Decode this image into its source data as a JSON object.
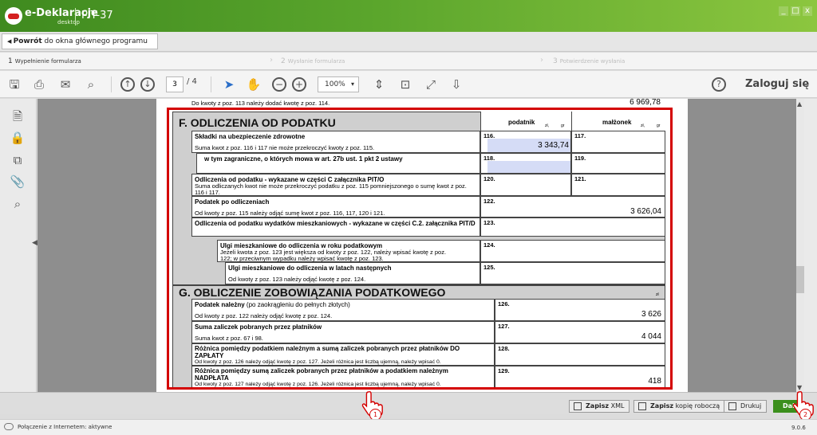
{
  "app": {
    "brand": "e-Deklaracje",
    "brand_sub": "desktop",
    "title": "PIT-37",
    "window_controls": [
      "_",
      "□",
      "x"
    ]
  },
  "nav": {
    "back_bold": "Powrót",
    "back_rest": " do okna głównego programu"
  },
  "steps": [
    {
      "num": "1",
      "label": "Wypełnienie formularza",
      "active": true
    },
    {
      "num": "2",
      "label": "Wysłanie formularza",
      "active": false
    },
    {
      "num": "3",
      "label": "Potwierdzenie wysłania",
      "active": false
    }
  ],
  "toolbar": {
    "page_current": "3",
    "page_total": "/ 4",
    "zoom": "100%",
    "login": "Zaloguj się",
    "icons": [
      "save-icon",
      "print-icon",
      "mail-icon",
      "search-icon",
      "arrow-up-icon",
      "arrow-down-icon",
      "cursor-icon",
      "hand-icon",
      "zoom-out-icon",
      "zoom-in-icon",
      "fit-height-icon",
      "fit-page-icon",
      "fullscreen-icon",
      "download-icon",
      "help-icon"
    ]
  },
  "sidebar_icons": [
    "document-icon",
    "lock-icon",
    "copy-icon",
    "attachment-icon",
    "search-icon"
  ],
  "form": {
    "top_note": "Do kwoty z poz. 113 należy dodać kwotę z poz. 114.",
    "top_value": "6 969,78",
    "section_f": {
      "title": "F. ODLICZENIA OD PODATKU",
      "col_podatnik": "podatnik",
      "col_malzonek": "małżonek",
      "unit_zl": "zł,",
      "unit_gr": "gr",
      "rows": [
        {
          "label": "Składki na ubezpieczenie zdrowotne",
          "note": "Suma kwot z poz. 116 i 117 nie może przekroczyć kwoty z poz. 115.",
          "pos_a": "116.",
          "val_a": "3 343,74",
          "pos_b": "117."
        },
        {
          "label": "w tym zagraniczne, o których mowa w art. 27b ust. 1 pkt 2 ustawy",
          "note": "",
          "pos_a": "118.",
          "val_a": "",
          "pos_b": "119."
        },
        {
          "label": "Odliczenia od podatku - wykazane w części C załącznika PIT/O",
          "note": "Suma odliczanych kwot nie może przekroczyć podatku z poz. 115 pomniejszonego o sumę kwot z poz. 116 i 117.",
          "pos_a": "120.",
          "val_a": "",
          "pos_b": "121."
        },
        {
          "label": "Podatek po odliczeniach",
          "note": "Od kwoty z poz. 115 należy odjąć sumę kwot z poz. 116, 117, 120 i 121.",
          "pos_a": "122.",
          "val_a": "3 626,04"
        },
        {
          "label": "Odliczenia od podatku wydatków mieszkaniowych - wykazane w części C.2. załącznika PIT/D",
          "note": "",
          "pos_a": "123.",
          "val_a": ""
        },
        {
          "label": "Ulgi mieszkaniowe do odliczenia w roku podatkowym",
          "note": "Jeżeli kwota z poz. 123 jest większa od kwoty z poz. 122, należy wpisać kwotę z poz. 122; w przeciwnym wypadku należy wpisać kwotę z poz. 123.",
          "pos_a": "124.",
          "val_a": ""
        },
        {
          "label": "Ulgi mieszkaniowe do odliczenia w latach następnych",
          "note": "Od kwoty z poz. 123 należy odjąć kwotę z poz. 124.",
          "pos_a": "125.",
          "val_a": ""
        }
      ]
    },
    "section_g": {
      "title": "G. OBLICZENIE ZOBOWIĄZANIA PODATKOWEGO",
      "unit_zl": "zł",
      "rows": [
        {
          "label": "Podatek należny",
          "label_extra": " (po zaokrągleniu do pełnych złotych)",
          "note": "Od kwoty z poz. 122 należy odjąć kwotę z poz. 124.",
          "pos": "126.",
          "val": "3 626"
        },
        {
          "label": "Suma zaliczek pobranych przez płatników",
          "label_extra": "",
          "note": "Suma kwot z poz. 67 i 98.",
          "pos": "127.",
          "val": "4 044"
        },
        {
          "label": "Różnica pomiędzy podatkiem należnym a sumą zaliczek pobranych przez płatników DO ZAPŁATY",
          "label_extra": "",
          "note": "Od kwoty z poz. 126 należy odjąć kwotę z poz. 127. Jeżeli różnica jest liczbą ujemną, należy wpisać 0.",
          "pos": "128.",
          "val": ""
        },
        {
          "label": "Różnica pomiędzy sumą zaliczek pobranych przez płatników a podatkiem należnym NADPŁATA",
          "label_extra": "",
          "note": "Od kwoty z poz. 127 należy odjąć kwotę z poz. 126. Jeżeli różnica jest liczbą ujemną, należy wpisać 0.",
          "pos": "129.",
          "val": "418"
        }
      ]
    }
  },
  "bottom": {
    "zapisz_xml_bold": "Zapisz",
    "zapisz_xml_rest": " XML",
    "zapisz_kopie_bold": "Zapisz",
    "zapisz_kopie_rest": " kopię roboczą",
    "drukuj": "Drukuj",
    "dalej": "Dalej"
  },
  "badges": [
    "1",
    "2"
  ],
  "status": {
    "text": "Połączenie z Internetem: aktywne",
    "version": "9.0.6"
  },
  "colors": {
    "accent_green": "#4a9a24",
    "highlight_red": "#d40000",
    "input_fill": "#d5dcf6"
  }
}
